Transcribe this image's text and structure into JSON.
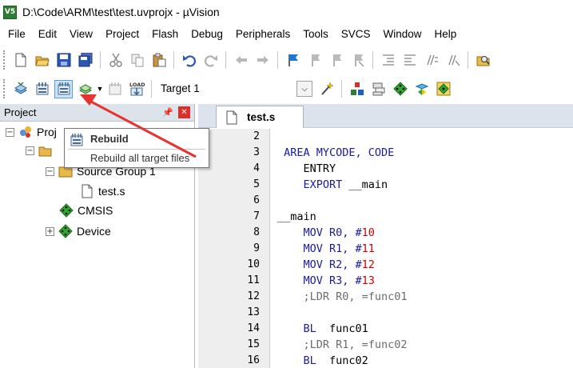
{
  "window": {
    "title": "D:\\Code\\ARM\\test\\test.uvprojx - µVision",
    "app_icon_text": "V5"
  },
  "menu": [
    "File",
    "Edit",
    "View",
    "Project",
    "Flash",
    "Debug",
    "Peripherals",
    "Tools",
    "SVCS",
    "Window",
    "Help"
  ],
  "toolbar2": {
    "target": "Target 1"
  },
  "project_panel": {
    "title": "Project",
    "tree": [
      {
        "label": "Proj",
        "level": 0
      },
      {
        "label": "",
        "level": 1
      },
      {
        "label": "Source Group 1",
        "level": 2
      },
      {
        "label": "test.s",
        "level": 3
      },
      {
        "label": "CMSIS",
        "level": 2
      },
      {
        "label": "Device",
        "level": 2
      }
    ]
  },
  "tooltip": {
    "title": "Rebuild",
    "description": "Rebuild all target files"
  },
  "editor": {
    "tab": "test.s",
    "line_numbers": [
      "2",
      "3",
      "4",
      "5",
      "6",
      "7",
      "8",
      "9",
      "10",
      "11",
      "12",
      "13",
      "14",
      "15",
      "16"
    ],
    "lines": [
      {
        "indent": "",
        "parts": []
      },
      {
        "indent": " ",
        "parts": [
          {
            "t": "AREA MYCODE, CODE",
            "c": "kw"
          }
        ]
      },
      {
        "indent": "    ",
        "parts": [
          {
            "t": "ENTRY",
            "c": "plain"
          }
        ]
      },
      {
        "indent": "    ",
        "parts": [
          {
            "t": "EXPORT ",
            "c": "kw"
          },
          {
            "t": "__main",
            "c": "plain"
          }
        ]
      },
      {
        "indent": "",
        "parts": []
      },
      {
        "indent": "",
        "parts": [
          {
            "t": "__main",
            "c": "plain"
          }
        ]
      },
      {
        "indent": "    ",
        "parts": [
          {
            "t": "MOV R0, #",
            "c": "kw"
          },
          {
            "t": "10",
            "c": "num"
          }
        ]
      },
      {
        "indent": "    ",
        "parts": [
          {
            "t": "MOV R1, #",
            "c": "kw"
          },
          {
            "t": "11",
            "c": "num"
          }
        ]
      },
      {
        "indent": "    ",
        "parts": [
          {
            "t": "MOV R2, #",
            "c": "kw"
          },
          {
            "t": "12",
            "c": "num"
          }
        ]
      },
      {
        "indent": "    ",
        "parts": [
          {
            "t": "MOV R3, #",
            "c": "kw"
          },
          {
            "t": "13",
            "c": "num"
          }
        ]
      },
      {
        "indent": "    ",
        "parts": [
          {
            "t": ";LDR R0, =func01",
            "c": "cmt"
          }
        ]
      },
      {
        "indent": "",
        "parts": []
      },
      {
        "indent": "    ",
        "parts": [
          {
            "t": "BL  ",
            "c": "kw"
          },
          {
            "t": "func01",
            "c": "plain"
          }
        ]
      },
      {
        "indent": "    ",
        "parts": [
          {
            "t": ";LDR R1, =func02",
            "c": "cmt"
          }
        ]
      },
      {
        "indent": "    ",
        "parts": [
          {
            "t": "BL  ",
            "c": "kw"
          },
          {
            "t": "func02",
            "c": "plain"
          }
        ]
      }
    ]
  }
}
